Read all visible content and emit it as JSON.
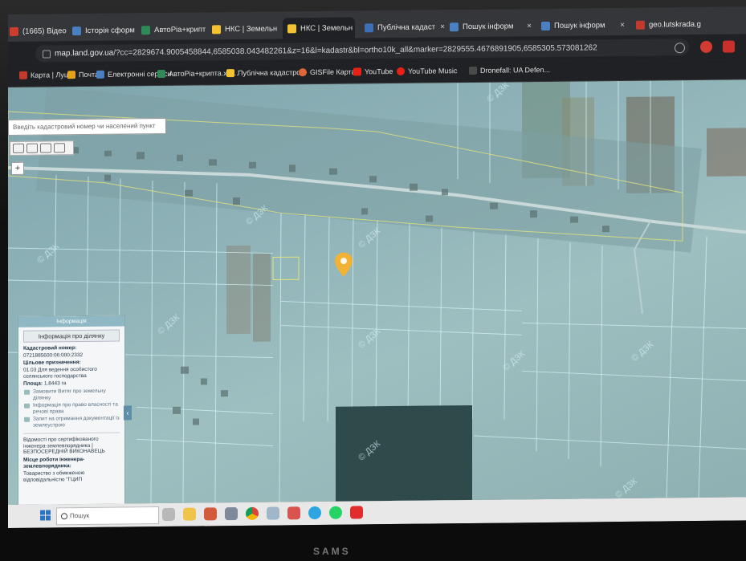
{
  "tabs": [
    {
      "label": "(1665) Відео -",
      "active": false,
      "favicon_color": "#cc3d2e"
    },
    {
      "label": "Історія сформ",
      "active": false,
      "favicon_color": "#4a7fc1"
    },
    {
      "label": "АвтоРіа+крипт",
      "active": false,
      "favicon_color": "#2e8b57"
    },
    {
      "label": "НКС | Земельн",
      "active": false,
      "favicon_color": "#f2c230"
    },
    {
      "label": "НКС | Земельн",
      "active": true,
      "favicon_color": "#f2c230"
    },
    {
      "label": "Публічна кадаст",
      "active": false,
      "favicon_color": "#3d6fb6"
    },
    {
      "label": "Пошук інформ",
      "active": false,
      "favicon_color": "#4a7fc1"
    },
    {
      "label": "Пошук інформ",
      "active": false,
      "favicon_color": "#4a7fc1"
    },
    {
      "label": "geo.lutskrada.g",
      "active": false,
      "favicon_color": "#c23a2b"
    }
  ],
  "tab_close_glyph": "×",
  "address": {
    "host": "map.land.gov.ua",
    "path": "/?cc=2829674.9005458844,6585038.043482261&z=16&l=kadastr&bl=ortho10k_all&marker=2829555.4676891905,6585305.573081262"
  },
  "bookmarks": [
    {
      "label": "Карта | Луцьк",
      "icon_color": "#c23a2b"
    },
    {
      "label": "Почта",
      "icon_color": "#e3a21a"
    },
    {
      "label": "Електронні сервіси...",
      "icon_color": "#4a7fc1"
    },
    {
      "label": "АвтоРіа+крипта.xls...",
      "icon_color": "#2e8b57"
    },
    {
      "label": "Публічна кадастро...",
      "icon_color": "#f2c230"
    },
    {
      "label": "GISFile Карта",
      "icon_color": "#e0653a"
    },
    {
      "label": "YouTube",
      "icon_color": "#e62117"
    },
    {
      "label": "YouTube Music",
      "icon_color": "#e62117"
    },
    {
      "label": "Dronefall: UA Defen...",
      "icon_color": "#4a4a4a"
    }
  ],
  "map": {
    "search_placeholder": "Введіть кадастровий номер чи населений пункт",
    "zoom_in_label": "+",
    "watermark": "© ДЗК",
    "collapse_glyph": "‹",
    "pin_color": "#f2b233"
  },
  "info_panel": {
    "header": "Інформація",
    "section_button": "Інформація про ділянку",
    "cadastral_label": "Кадастровий номер:",
    "cadastral_value": "0721885600:06:000:2332",
    "purpose_label": "Цільове призначення:",
    "purpose_value": "01.03 Для ведення особистого селянського господарства",
    "area_label": "Площа:",
    "area_value": "1.8443 га",
    "links": [
      "Замовити Витяг про земельну ділянку",
      "Інформація про право власності та речові права",
      "Запит на отримання документації із землеустрою"
    ],
    "engineer_note": "Відомості про сертифікованого інженера-землевпорядника | БЕЗПОСЕРЕДНІЙ ВИКОНАВЕЦЬ",
    "workplace_label": "Місце роботи інженера-землевпорядника:",
    "workplace_value": "Товариство з обмеженою відповідальністю \"ГЦИП"
  },
  "taskbar": {
    "search_placeholder": "Пошук",
    "apps": [
      "chrome",
      "files",
      "camera",
      "mail",
      "telegram",
      "whatsapp",
      "acrobat"
    ]
  },
  "monitor_brand": "SAMS"
}
